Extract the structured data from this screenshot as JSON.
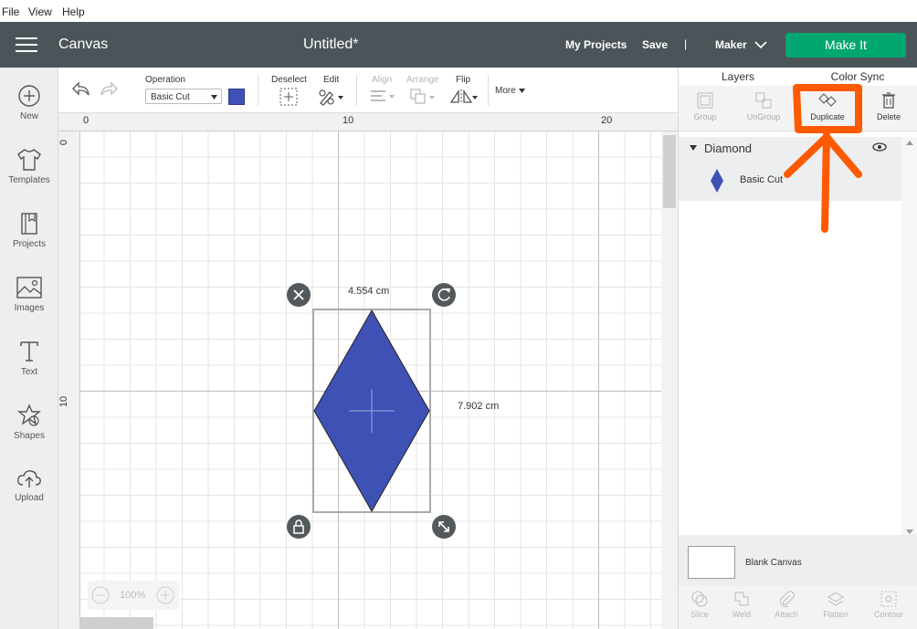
{
  "menu": [
    "File",
    "View",
    "Help"
  ],
  "header": {
    "app_title": "Canvas",
    "doc_title": "Untitled*",
    "my_projects": "My Projects",
    "save": "Save",
    "separator": "|",
    "machine": "Maker",
    "make_it": "Make It"
  },
  "sidebar": [
    {
      "label": "New",
      "icon": "plus-circle-icon"
    },
    {
      "label": "Templates",
      "icon": "tshirt-icon"
    },
    {
      "label": "Projects",
      "icon": "book-icon"
    },
    {
      "label": "Images",
      "icon": "image-icon"
    },
    {
      "label": "Text",
      "icon": "text-icon"
    },
    {
      "label": "Shapes",
      "icon": "shapes-icon"
    },
    {
      "label": "Upload",
      "icon": "upload-cloud-icon"
    }
  ],
  "toolbar": {
    "operation_label": "Operation",
    "operation_value": "Basic Cut",
    "operation_color": "#3f51b5",
    "deselect": "Deselect",
    "edit": "Edit",
    "align": "Align",
    "arrange": "Arrange",
    "flip": "Flip",
    "more": "More"
  },
  "rulers": {
    "top": [
      "0",
      "10",
      "20"
    ],
    "left": [
      "0",
      "10"
    ]
  },
  "selection": {
    "width": "4.554 cm",
    "height": "7.902 cm",
    "shape_color": "#3f51b5"
  },
  "zoom": "100%",
  "panel": {
    "tabs": [
      "Layers",
      "Color Sync"
    ],
    "actions": [
      "Group",
      "UnGroup",
      "Duplicate",
      "Delete"
    ],
    "layer_group": "Diamond",
    "layer_item": "Basic Cut",
    "blank_canvas": "Blank Canvas",
    "bottom_actions": [
      "Slice",
      "Weld",
      "Attach",
      "Flatten",
      "Contour"
    ]
  },
  "colors": {
    "header_bg": "#4b5559",
    "make_it_bg": "#00a770",
    "annotation": "#ff5a00"
  }
}
